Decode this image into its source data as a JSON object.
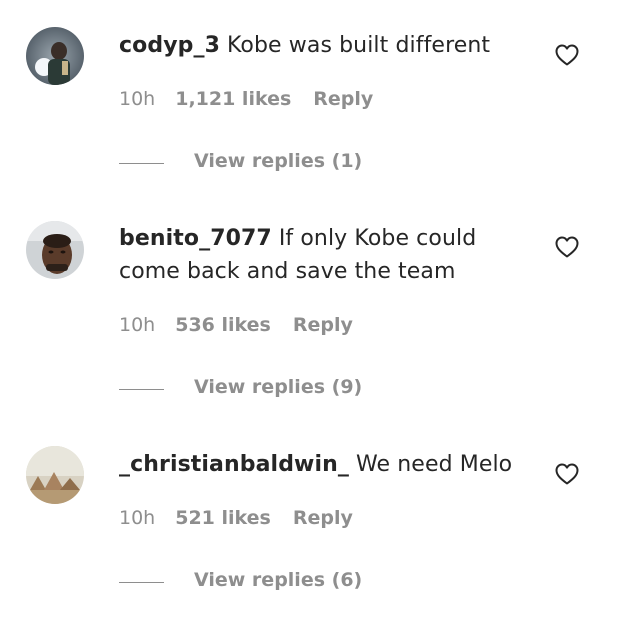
{
  "comments": [
    {
      "username": "codyp_3",
      "text": "Kobe was built different",
      "time": "10h",
      "likes": "1,121 likes",
      "reply_label": "Reply",
      "view_replies": "View replies (1)"
    },
    {
      "username": "benito_7077",
      "text": "If only Kobe could come back and save the team",
      "time": "10h",
      "likes": "536 likes",
      "reply_label": "Reply",
      "view_replies": "View replies (9)"
    },
    {
      "username": "_christianbaldwin_",
      "text": "We need Melo",
      "time": "10h",
      "likes": "521 likes",
      "reply_label": "Reply",
      "view_replies": "View replies (6)"
    }
  ],
  "icons": {
    "like": "heart-outline-icon"
  },
  "colors": {
    "text": "#262626",
    "secondary": "#8e8e8e"
  }
}
